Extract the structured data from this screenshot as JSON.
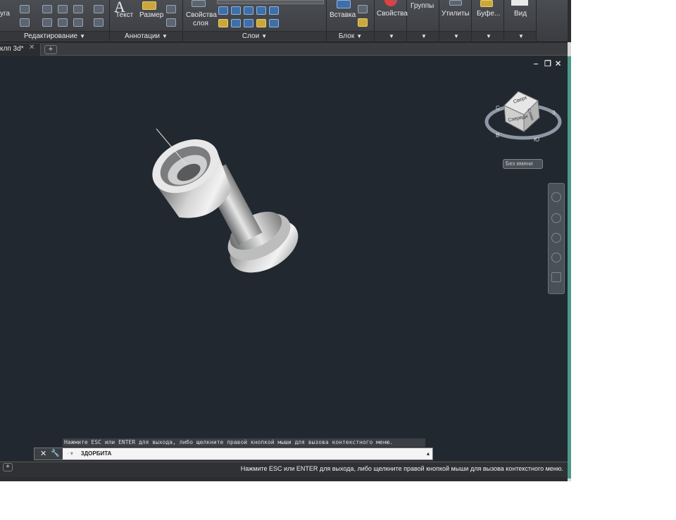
{
  "ribbon": {
    "panels": {
      "edit": "Редактирование",
      "annotations": "Аннотации",
      "layers": "Слои",
      "block": "Блок"
    },
    "buttons": {
      "arc_partial": "уга",
      "text": "Текст",
      "dimension": "Размер",
      "layer_props_line1": "Свойства",
      "layer_props_line2": "слоя",
      "insert": "Вставка",
      "properties": "Свойства",
      "groups": "Группы",
      "utilities": "Утилиты",
      "clipboard": "Буфе...",
      "view": "Вид"
    }
  },
  "tabs": {
    "active": "клп 3d*",
    "close_glyph": "✕",
    "add_glyph": "+"
  },
  "viewport": {
    "window_controls": {
      "minimize": "‒",
      "restore": "❐",
      "close": "✕"
    },
    "viewcube": {
      "top_face": "Сверх",
      "front_face": "Спереди",
      "side_face": "Слева",
      "compass": {
        "east": "В",
        "south": "Ю",
        "west": "З",
        "north": "С"
      }
    },
    "ucs_menu": "Без имени"
  },
  "command": {
    "hint": "Нажмите ESC или ENTER для выхода, либо щелкните правой кнопкой мыши для вызова контекстного меню.",
    "close_glyph": "✕",
    "customize_glyph": "🔧",
    "prompt_glyph": "· ▾",
    "current_command": "3ДОРБИТА",
    "history_glyph": "▴"
  },
  "statusbar": {
    "add_glyph": "+",
    "message": "Нажмите ESC или ENTER для выхода, либо щелкните правой кнопкой мыши для вызова контекстного меню."
  }
}
